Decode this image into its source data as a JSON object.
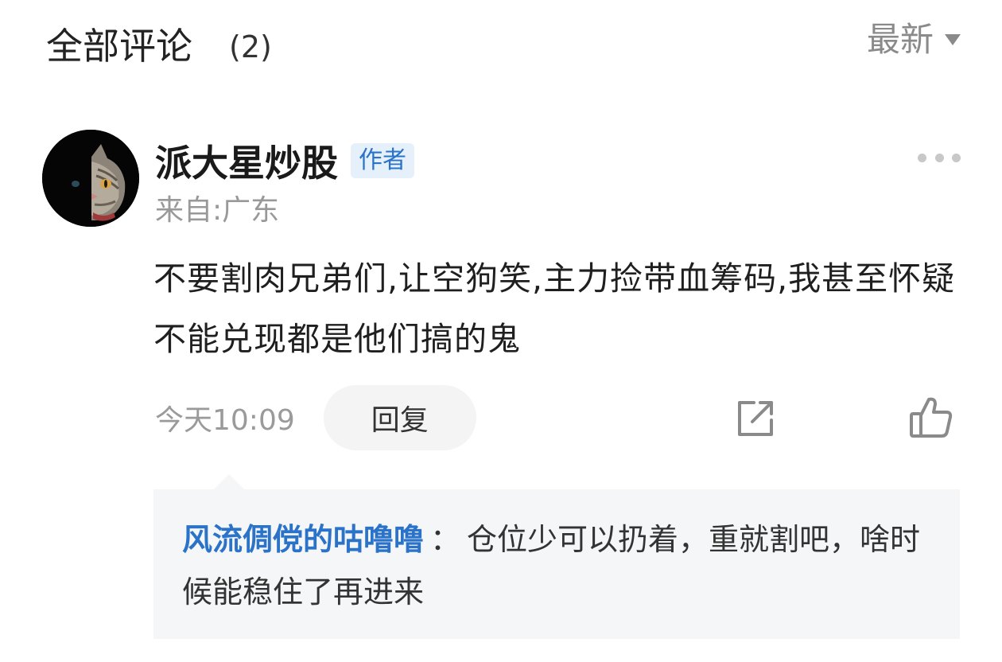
{
  "header": {
    "title": "全部评论",
    "count": "(2)",
    "sort_label": "最新",
    "sort_icon": "caret-down-icon"
  },
  "comment": {
    "author": "派大星炒股",
    "badge": "作者",
    "location": "来自:广东",
    "more_icon": "more-dots-icon",
    "text": "不要割肉兄弟们,让空狗笑,主力捡带血筹码,我甚至怀疑不能兑现都是他们搞的鬼",
    "timestamp": "今天10:09",
    "reply_label": "回复",
    "share_icon": "share-icon",
    "like_icon": "thumbs-up-icon"
  },
  "sub_reply": {
    "user": "风流倜傥的咕噜噜",
    "separator": "：",
    "text": "仓位少可以扔着，重就割吧，啥时候能稳住了再进来"
  },
  "colors": {
    "accent_blue": "#2a73c9",
    "badge_bg": "#e6f0fb",
    "reply_bg": "#f5f6f7",
    "muted_text": "#999999"
  }
}
